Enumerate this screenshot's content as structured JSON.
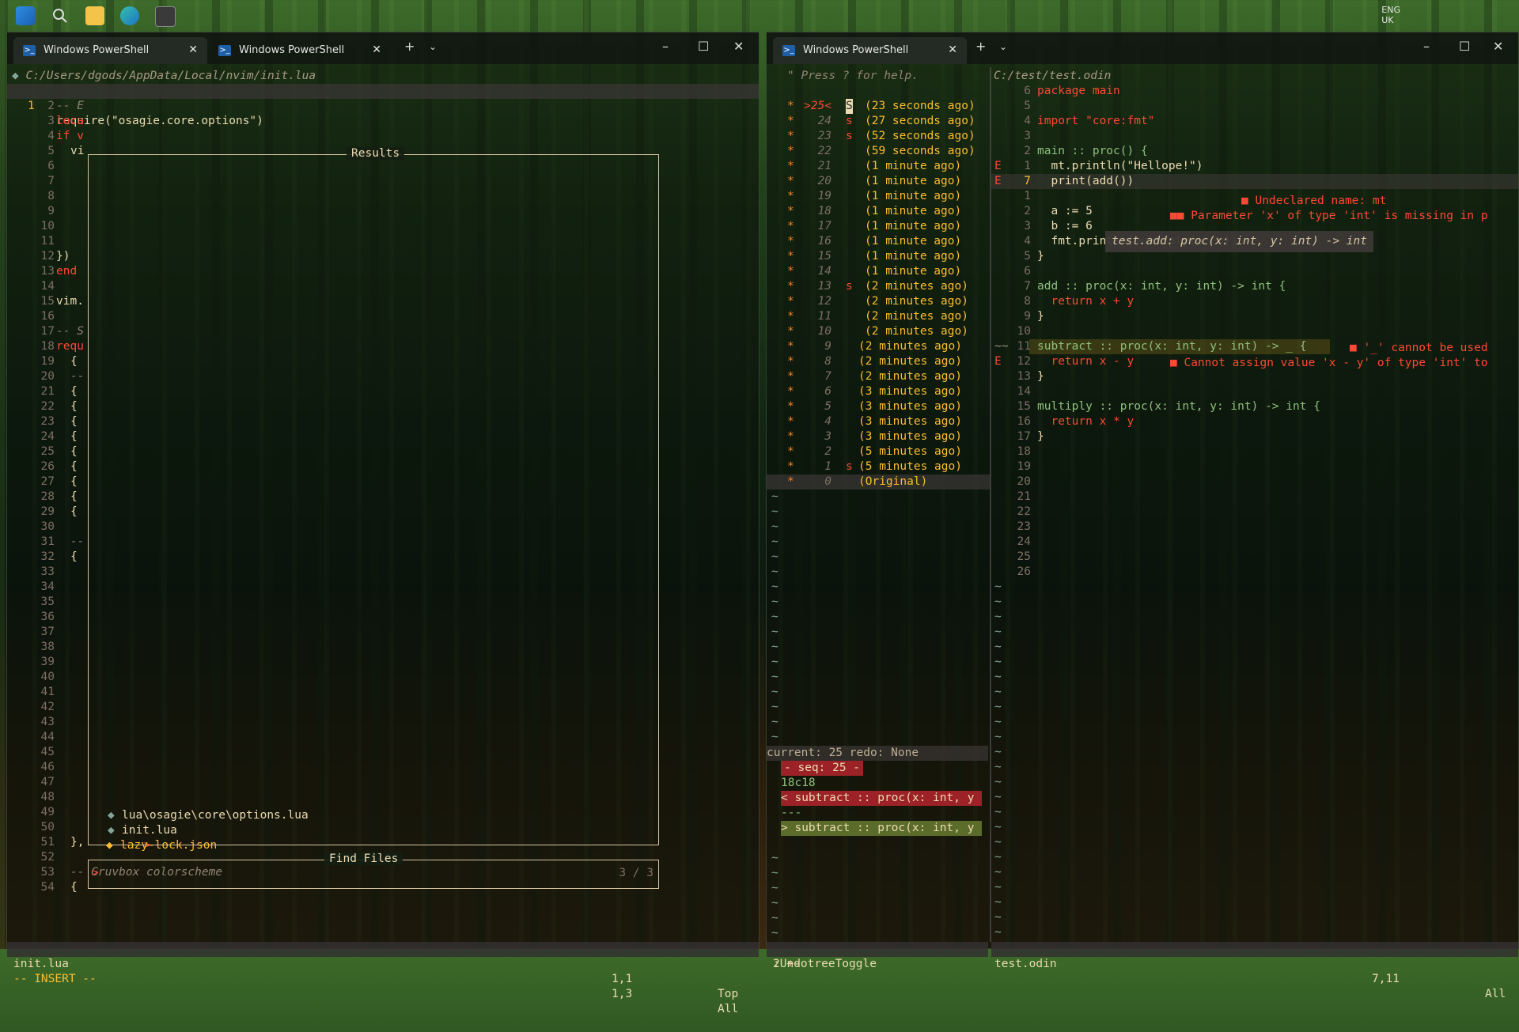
{
  "taskbar": {
    "icons": [
      "windows-start-icon",
      "search-icon",
      "file-explorer-icon",
      "edge-icon",
      "terminal-icon"
    ],
    "tray_lang": "ENG",
    "tray_region": "UK"
  },
  "left_window": {
    "tabs": [
      {
        "label": "Windows PowerShell",
        "active": true
      },
      {
        "label": "Windows PowerShell",
        "active": false
      }
    ],
    "path": "C:/Users/dgods/AppData/Local/nvim/init.lua",
    "first_line_num": "1",
    "first_line_code": "require(\"osagie.core.options\")",
    "gutter": [
      "1",
      "2",
      "3",
      "4",
      "5",
      "6",
      "7",
      "8",
      "9",
      "10",
      "11",
      "12",
      "13",
      "14",
      "15",
      "16",
      "17",
      "18",
      "19",
      "20",
      "21",
      "22",
      "23",
      "24",
      "25",
      "26",
      "27",
      "28",
      "29",
      "30",
      "31",
      "32",
      "33",
      "34",
      "35",
      "36",
      "37",
      "38",
      "39",
      "40",
      "41",
      "42",
      "43",
      "44",
      "45",
      "46",
      "47",
      "48",
      "49",
      "50",
      "51",
      "52",
      "53",
      "54"
    ],
    "code_fragments": {
      "l2": "-- E",
      "l3": "loca",
      "l4": "if v",
      "l5": "vi",
      "l12": "})",
      "l13": "end",
      "l15": "vim.",
      "l17": "-- S",
      "l18": "requ",
      "l19": "{",
      "l20": "--",
      "l21": "{",
      "l22": "{",
      "l23": "{",
      "l24": "{",
      "l25": "{",
      "l26": "{",
      "l27": "{",
      "l28": "{",
      "l29": "{",
      "l31": "--",
      "l32": "{",
      "l51": "},",
      "l53": "-- Gruvbox colorscheme",
      "l54": "{"
    },
    "results_title": "Results",
    "results": [
      {
        "marker": "",
        "name": "lua\\osagie\\core\\options.lua"
      },
      {
        "marker": "",
        "name": "init.lua"
      },
      {
        "marker": ">",
        "name": "lazy-lock.json"
      }
    ],
    "find_title": "Find Files",
    "prompt": ">",
    "count": "3 / 3",
    "status_file": "init.lua",
    "status_pos": "1,1",
    "status_scroll": "Top",
    "mode": "-- INSERT --",
    "cmd_pos": "1,3",
    "cmd_scroll": "All"
  },
  "right_window": {
    "tab_label": "Windows PowerShell",
    "help": "\" Press ? for help.",
    "undo_entries": [
      {
        "seq": ">25<",
        "flag": "S",
        "time": "(23 seconds ago)"
      },
      {
        "seq": "24",
        "flag": "s",
        "time": "(27 seconds ago)"
      },
      {
        "seq": "23",
        "flag": "s",
        "time": "(52 seconds ago)"
      },
      {
        "seq": "22",
        "flag": "",
        "time": "(59 seconds ago)"
      },
      {
        "seq": "21",
        "flag": "",
        "time": "(1 minute ago)"
      },
      {
        "seq": "20",
        "flag": "",
        "time": "(1 minute ago)"
      },
      {
        "seq": "19",
        "flag": "",
        "time": "(1 minute ago)"
      },
      {
        "seq": "18",
        "flag": "",
        "time": "(1 minute ago)"
      },
      {
        "seq": "17",
        "flag": "",
        "time": "(1 minute ago)"
      },
      {
        "seq": "16",
        "flag": "",
        "time": "(1 minute ago)"
      },
      {
        "seq": "15",
        "flag": "",
        "time": "(1 minute ago)"
      },
      {
        "seq": "14",
        "flag": "",
        "time": "(1 minute ago)"
      },
      {
        "seq": "13",
        "flag": "s",
        "time": "(2 minutes ago)"
      },
      {
        "seq": "12",
        "flag": "",
        "time": "(2 minutes ago)"
      },
      {
        "seq": "11",
        "flag": "",
        "time": "(2 minutes ago)"
      },
      {
        "seq": "10",
        "flag": "",
        "time": "(2 minutes ago)"
      },
      {
        "seq": "9",
        "flag": "",
        "time": "(2 minutes ago)"
      },
      {
        "seq": "8",
        "flag": "",
        "time": "(2 minutes ago)"
      },
      {
        "seq": "7",
        "flag": "",
        "time": "(2 minutes ago)"
      },
      {
        "seq": "6",
        "flag": "",
        "time": "(3 minutes ago)"
      },
      {
        "seq": "5",
        "flag": "",
        "time": "(3 minutes ago)"
      },
      {
        "seq": "4",
        "flag": "",
        "time": "(3 minutes ago)"
      },
      {
        "seq": "3",
        "flag": "",
        "time": "(3 minutes ago)"
      },
      {
        "seq": "2",
        "flag": "",
        "time": "(5 minutes ago)"
      },
      {
        "seq": "1",
        "flag": "s",
        "time": "(5 minutes ago)"
      },
      {
        "seq": "0",
        "flag": "",
        "time": "(Original)"
      }
    ],
    "diff_header": "current: 25 redo: None",
    "diff_seq": "- seq: 25 -",
    "diff_hunk": "18c18",
    "diff_old": "< subtract :: proc(x: int, y",
    "diff_sep": "---",
    "diff_new": "> subtract :: proc(x: int, y",
    "undo_status_left": "2 +-",
    "cmd": ":UndotreeToggle",
    "code_path": "C:/test/test.odin",
    "code_lines": [
      {
        "sign": "",
        "num": "6",
        "code": "package main"
      },
      {
        "sign": "",
        "num": "5",
        "code": ""
      },
      {
        "sign": "",
        "num": "4",
        "code": "import \"core:fmt\""
      },
      {
        "sign": "",
        "num": "3",
        "code": ""
      },
      {
        "sign": "",
        "num": "2",
        "code": "main :: proc() {"
      },
      {
        "sign": "E",
        "num": "1",
        "code": "  mt.println(\"Hellope!\")"
      },
      {
        "sign": "E",
        "num": "7",
        "code": "  print(add())"
      },
      {
        "sign": "",
        "num": "1",
        "code": ""
      },
      {
        "sign": "",
        "num": "2",
        "code": "  a := 5"
      },
      {
        "sign": "",
        "num": "3",
        "code": "  b := 6"
      },
      {
        "sign": "",
        "num": "4",
        "code": "  fmt.println(multiply(a, b))"
      },
      {
        "sign": "",
        "num": "5",
        "code": "}"
      },
      {
        "sign": "",
        "num": "6",
        "code": ""
      },
      {
        "sign": "",
        "num": "7",
        "code": "add :: proc(x: int, y: int) -> int {"
      },
      {
        "sign": "",
        "num": "8",
        "code": "  return x + y"
      },
      {
        "sign": "",
        "num": "9",
        "code": "}"
      },
      {
        "sign": "",
        "num": "10",
        "code": ""
      },
      {
        "sign": "~~",
        "num": "11",
        "code": "subtract :: proc(x: int, y: int) -> _ {"
      },
      {
        "sign": "E",
        "num": "12",
        "code": "  return x - y"
      },
      {
        "sign": "",
        "num": "13",
        "code": "}"
      },
      {
        "sign": "",
        "num": "14",
        "code": ""
      },
      {
        "sign": "",
        "num": "15",
        "code": "multiply :: proc(x: int, y: int) -> int {"
      },
      {
        "sign": "",
        "num": "16",
        "code": "  return x * y"
      },
      {
        "sign": "",
        "num": "17",
        "code": "}"
      },
      {
        "sign": "",
        "num": "18",
        "code": ""
      },
      {
        "sign": "",
        "num": "19",
        "code": ""
      },
      {
        "sign": "",
        "num": "20",
        "code": ""
      },
      {
        "sign": "",
        "num": "21",
        "code": ""
      },
      {
        "sign": "",
        "num": "22",
        "code": ""
      },
      {
        "sign": "",
        "num": "23",
        "code": ""
      },
      {
        "sign": "",
        "num": "24",
        "code": ""
      },
      {
        "sign": "",
        "num": "25",
        "code": ""
      },
      {
        "sign": "",
        "num": "26",
        "code": ""
      }
    ],
    "diagnostics": {
      "d1": "■ Undeclared name: mt",
      "d2": "■■ Parameter 'x' of type 'int' is missing in p",
      "d3": "■ '_' cannot be used",
      "d4": "■ Cannot assign value 'x - y' of type 'int' to"
    },
    "hover_sig": "test.add: proc(x: int, y: int) -> int",
    "status_file": "test.odin",
    "status_pos": "7,11",
    "status_scroll": "All"
  },
  "colors": {
    "fg": "#ebdbb2",
    "red": "#fb4934",
    "green": "#b8bb26",
    "yellow": "#fabd2f",
    "orange": "#fe8019",
    "gray": "#928374"
  }
}
